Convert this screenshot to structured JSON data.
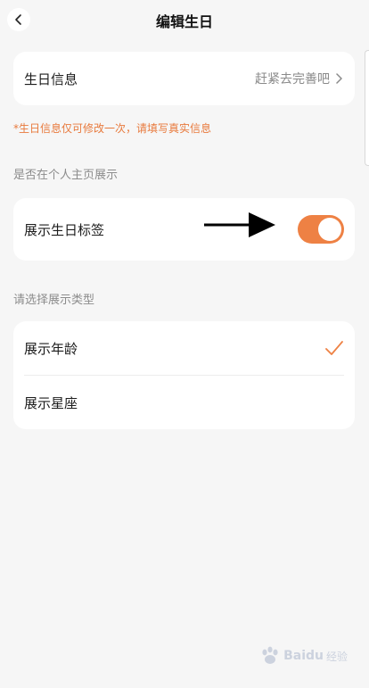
{
  "header": {
    "title": "编辑生日",
    "back_icon": "chevron-left-icon"
  },
  "birthday_card": {
    "label": "生日信息",
    "hint": "赶紧去完善吧",
    "chevron_icon": "chevron-right-icon"
  },
  "note": "*生日信息仅可修改一次，请填写真实信息",
  "profile_section": {
    "title": "是否在个人主页展示",
    "toggle_label": "展示生日标签",
    "toggle_on": true,
    "toggle_color": "#ee8144"
  },
  "type_section": {
    "title": "请选择展示类型",
    "options": [
      {
        "label": "展示年龄",
        "selected": true
      },
      {
        "label": "展示星座",
        "selected": false
      }
    ],
    "check_color": "#ee8144"
  },
  "watermark": {
    "brand": "Baidu",
    "suffix": "经验"
  }
}
